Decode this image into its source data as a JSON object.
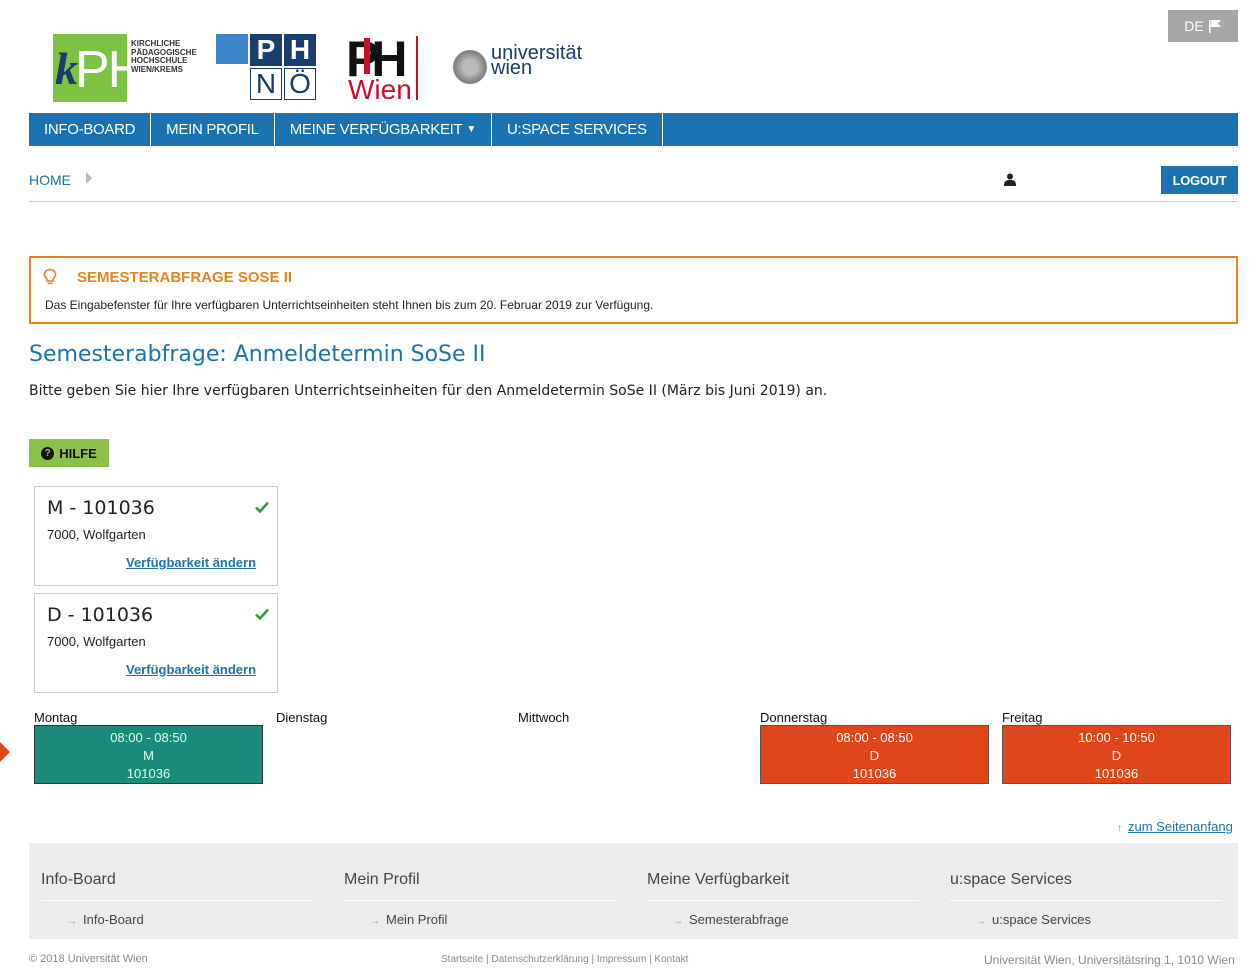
{
  "language": {
    "label": "DE",
    "icon": "flag-icon"
  },
  "logos": {
    "kph_text": "KIRCHLICHE PÄDAGOGISCHE HOCHSCHULE WIEN/KREMS",
    "kph_k": "k",
    "kph_ph": "PH",
    "phnoe": [
      "P",
      "H",
      "N",
      "Ö"
    ],
    "phwien_ph": "PH",
    "phwien_wien": "Wien",
    "uni_text": "universität wien"
  },
  "nav": {
    "items": [
      "INFO-BOARD",
      "MEIN PROFIL",
      "MEINE VERFÜGBARKEIT",
      "U:SPACE SERVICES"
    ]
  },
  "breadcrumb": {
    "home": "HOME"
  },
  "logout_label": "LOGOUT",
  "notice": {
    "title": "SEMESTERABFRAGE SOSE II",
    "text": "Das Eingabefenster für Ihre verfügbaren Unterrichtseinheiten steht Ihnen bis zum 20. Februar 2019 zur Verfügung."
  },
  "page": {
    "title": "Semesterabfrage: Anmeldetermin SoSe II",
    "intro": "Bitte geben Sie hier Ihre verfügbaren Unterrichtseinheiten für den Anmeldetermin SoSe II (März bis Juni 2019) an.",
    "help_label": "HILFE"
  },
  "cards": [
    {
      "code": "M - 101036",
      "address": "7000, Wolfgarten",
      "link": "Verfügbarkeit ändern"
    },
    {
      "code": "D - 101036",
      "address": "7000, Wolfgarten",
      "link": "Verfügbarkeit ändern"
    }
  ],
  "schedule": {
    "days": [
      "Montag",
      "Dienstag",
      "Mittwoch",
      "Donnerstag",
      "Freitag"
    ],
    "slots": [
      {
        "day": "Montag",
        "time": "08:00 - 08:50",
        "type": "M",
        "id": "101036",
        "color": "#1a8a7a"
      },
      {
        "day": "Donnerstag",
        "time": "08:00 - 08:50",
        "type": "D",
        "id": "101036",
        "color": "#e0461a"
      },
      {
        "day": "Freitag",
        "time": "10:00 - 10:50",
        "type": "D",
        "id": "101036",
        "color": "#e0461a"
      }
    ]
  },
  "top_link": "zum Seitenanfang",
  "footer": {
    "columns": [
      {
        "heading": "Info-Board",
        "link": "Info-Board"
      },
      {
        "heading": "Mein Profil",
        "link": "Mein Profil"
      },
      {
        "heading": "Meine Verfügbarkeit",
        "link": "Semesterabfrage"
      },
      {
        "heading": "u:space Services",
        "link": "u:space Services"
      }
    ],
    "copyright": "© 2018 Universität Wien",
    "legal": "Startseite | Datenschutzerklärung | Impressum | Kontakt",
    "address": "Universität Wien, Universitätsring 1, 1010 Wien"
  }
}
